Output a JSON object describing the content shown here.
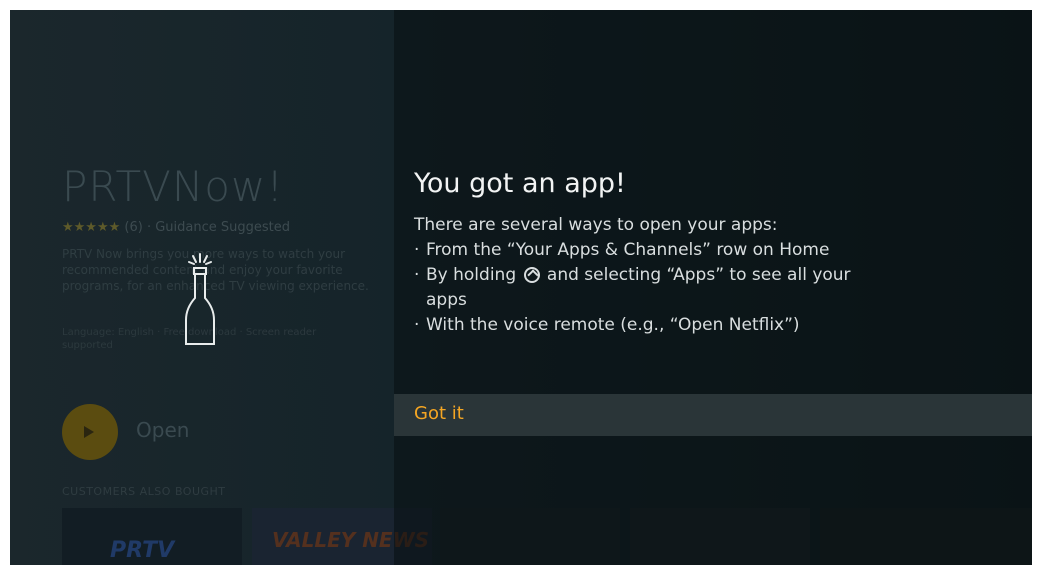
{
  "background": {
    "app_title": "PRTVNow!",
    "rating_stars": "★★★★★",
    "rating_text": "(6) · Guidance Suggested",
    "description": "PRTV Now brings you more ways to watch your recommended content and enjoy your favorite programs, for an enhanced TV viewing experience.",
    "meta": "Language: English · Free download · Screen reader supported",
    "open_label": "Open",
    "section_label": "CUSTOMERS ALSO BOUGHT",
    "tile1_text": "PRTV",
    "tile2_text": "VALLEY NEWS"
  },
  "dialog": {
    "title": "You got an app!",
    "intro": "There are several ways to open your apps:",
    "bullet1": "From the “Your Apps & Channels” row on Home",
    "bullet2_pre": "By holding",
    "bullet2_post": "and selecting “Apps” to see all your",
    "bullet2_cont": "apps",
    "bullet3": "With the voice remote (e.g., “Open Netflix”)",
    "bullet_char": "·",
    "button_label": "Got it",
    "icon": "champagne-bottle-icon",
    "home_icon": "home-button-icon",
    "accent_color": "#f5a623"
  }
}
